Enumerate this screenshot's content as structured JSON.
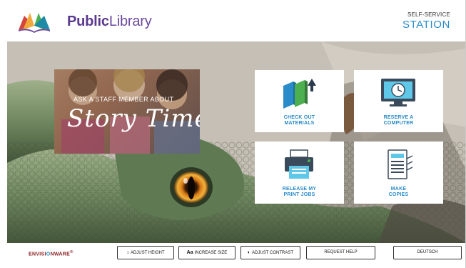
{
  "header": {
    "brand_bold": "Public",
    "brand_light": "Library",
    "station_small": "SELF-SERVICE",
    "station_big": "STATION",
    "logo_icon": "open-book-logo-icon"
  },
  "promo": {
    "ask": "ASK A STAFF MEMBER ABOUT",
    "script": "Story Time"
  },
  "tiles": [
    {
      "label_1": "CHECK OUT",
      "label_2": "MATERIALS",
      "icon": "books-icon"
    },
    {
      "label_1": "RESERVE A",
      "label_2": "COMPUTER",
      "icon": "computer-clock-icon"
    },
    {
      "label_1": "RELEASE MY",
      "label_2": "PRINT JOBS",
      "icon": "printer-icon"
    },
    {
      "label_1": "MAKE",
      "label_2": "COPIES",
      "icon": "copier-icon"
    }
  ],
  "footer": {
    "envision_a": "ENVISI",
    "envision_o": "O",
    "envision_b": "NWARE",
    "envision_tm": "®",
    "adjust_height": "ADJUST HEIGHT",
    "increase_size_glyph": "Aa",
    "increase_size": "INCREASE SIZE",
    "adjust_contrast": "ADJUST CONTRAST",
    "request_help": "REQUEST HELP",
    "language": "DEUTSCH"
  },
  "colors": {
    "brand_purple": "#5b3a8f",
    "accent_blue": "#2a8bc9",
    "logo_red": "#d6453d",
    "logo_orange": "#f2a93b",
    "logo_green": "#4caf50",
    "logo_teal": "#1e8aa6"
  }
}
